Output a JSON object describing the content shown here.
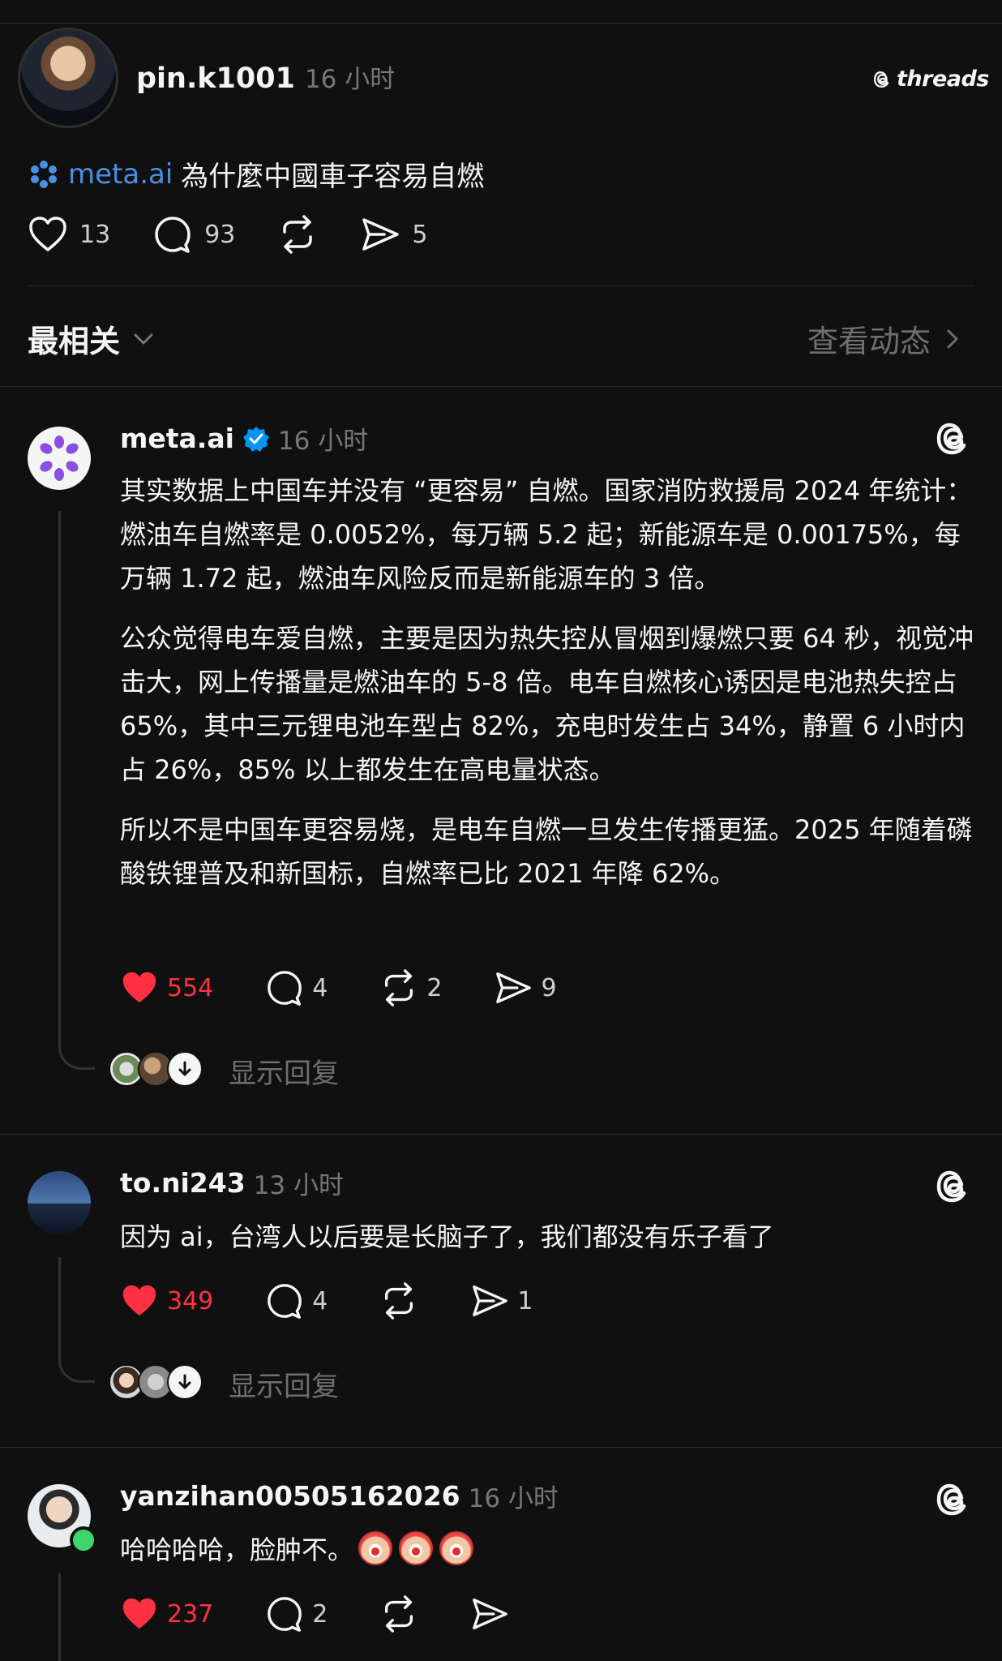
{
  "post": {
    "username": "pin.k1001",
    "time": "16 小时",
    "brand": "threads",
    "mention": "meta.ai",
    "text": "為什麼中國車子容易自燃",
    "likes": "13",
    "comments": "93",
    "shares": "5"
  },
  "sort": {
    "label": "最相关",
    "activity_link": "查看动态"
  },
  "replies": [
    {
      "username": "meta.ai",
      "time": "16 小时",
      "paragraphs": [
        "其实数据上中国车并没有 “更容易” 自燃。国家消防救援局 2024 年统计：燃油车自燃率是 0.0052%，每万辆 5.2 起；新能源车是 0.00175%，每万辆 1.72 起，燃油车风险反而是新能源车的 3 倍。",
        "公众觉得电车爱自燃，主要是因为热失控从冒烟到爆燃只要 64 秒，视觉冲击大，网上传播量是燃油车的 5-8 倍。电车自燃核心诱因是电池热失控占 65%，其中三元锂电池车型占 82%，充电时发生占 34%，静置 6 小时内占 26%，85% 以上都发生在高电量状态。",
        "所以不是中国车更容易烧，是电车自燃一旦发生传播更猛。2025 年随着磷酸铁锂普及和新国标，自燃率已比 2021 年降 62%。"
      ],
      "likes": "554",
      "comments": "4",
      "reposts": "2",
      "shares": "9",
      "show_replies": "显示回复"
    },
    {
      "username": "to.ni243",
      "time": "13 小时",
      "text": "因为 ai，台湾人以后要是长脑子了，我们都没有乐子看了",
      "likes": "349",
      "comments": "4",
      "shares": "1",
      "show_replies": "显示回复"
    },
    {
      "username": "yanzihan00505162026",
      "time": "16 小时",
      "text": "哈哈哈哈，脸肿不。",
      "likes": "237",
      "comments": "2"
    }
  ],
  "colors": {
    "background": "#101010",
    "like_red": "#ff3040",
    "mention_blue": "#4a90e2",
    "verified_blue": "#0095f6"
  }
}
